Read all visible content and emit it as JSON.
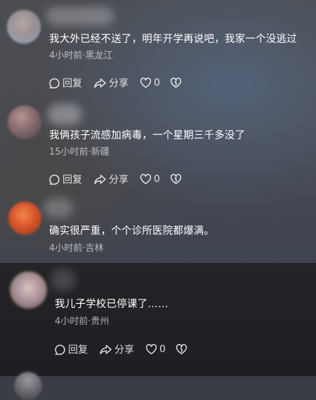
{
  "comments": [
    {
      "text": "我大外已经不送了，明年开学再说吧，我家一个没逃过",
      "meta": "4小时前·黑龙江",
      "reply_label": "回复",
      "share_label": "分享",
      "like_count": "0"
    },
    {
      "text": "我俩孩子流感加病毒，一个星期三千多没了",
      "meta": "15小时前·新疆",
      "reply_label": "回复",
      "share_label": "分享",
      "like_count": "0"
    },
    {
      "text": "确实很严重，个个诊所医院都爆满。",
      "meta": "4小时前·吉林"
    },
    {
      "text": "我儿子学校已停课了……",
      "meta": "4小时前·贵州",
      "reply_label": "回复",
      "share_label": "分享",
      "like_count": "0"
    }
  ]
}
